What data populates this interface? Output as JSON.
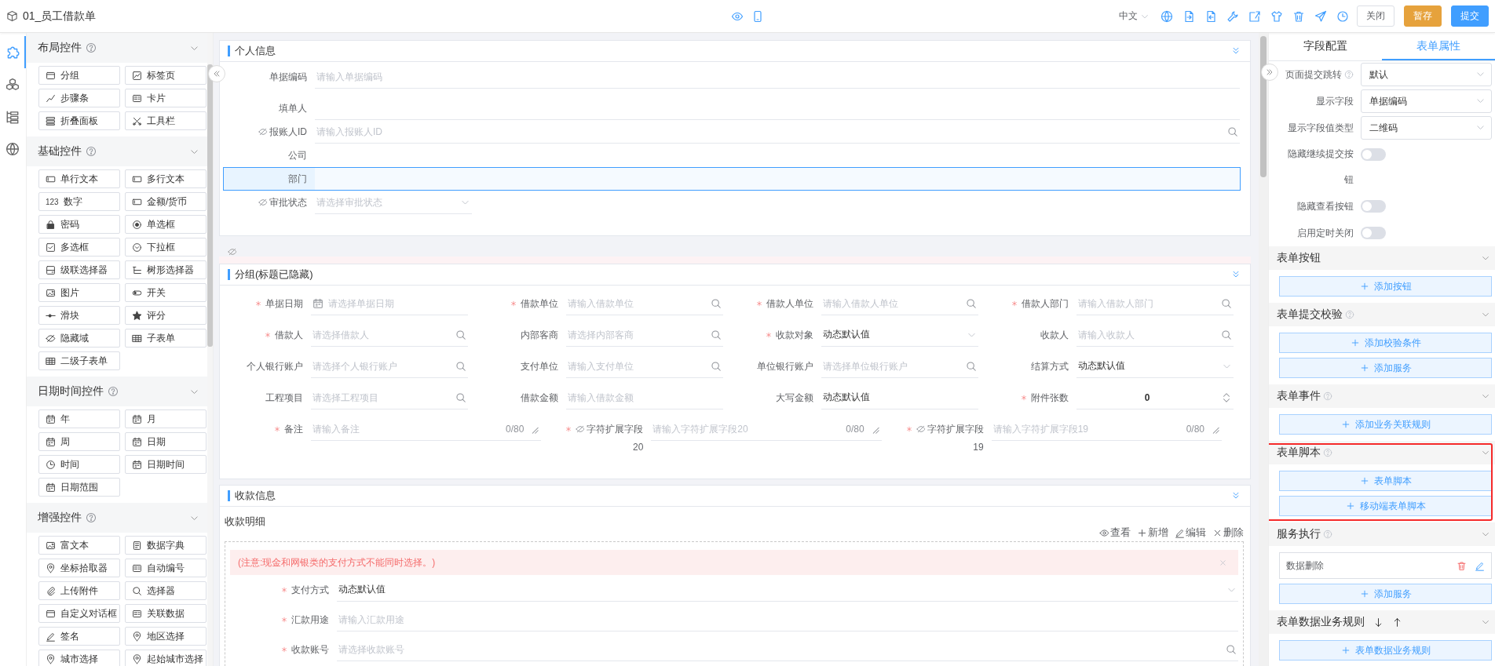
{
  "header": {
    "title": "01_员工借款单",
    "language": "中文",
    "buttons": [
      {
        "label": "关闭",
        "kind": "default"
      },
      {
        "label": "暂存",
        "kind": "warning"
      },
      {
        "label": "提交",
        "kind": "primary"
      }
    ]
  },
  "rail": [
    {
      "selected": true
    },
    {
      "selected": false
    },
    {
      "selected": false
    },
    {
      "selected": false
    }
  ],
  "palette": [
    {
      "title": "布局控件",
      "help": true,
      "items": [
        {
          "label": "分组"
        },
        {
          "label": "标签页"
        },
        {
          "label": "步骤条"
        },
        {
          "label": "卡片"
        },
        {
          "label": "折叠面板"
        },
        {
          "label": "工具栏"
        }
      ]
    },
    {
      "title": "基础控件",
      "help": true,
      "items": [
        {
          "label": "单行文本"
        },
        {
          "label": "多行文本"
        },
        {
          "label": "数字",
          "badge": "123"
        },
        {
          "label": "金额/货币"
        },
        {
          "label": "密码"
        },
        {
          "label": "单选框"
        },
        {
          "label": "多选框"
        },
        {
          "label": "下拉框"
        },
        {
          "label": "级联选择器"
        },
        {
          "label": "树形选择器"
        },
        {
          "label": "图片"
        },
        {
          "label": "开关"
        },
        {
          "label": "滑块"
        },
        {
          "label": "评分"
        },
        {
          "label": "隐藏域"
        },
        {
          "label": "子表单"
        },
        {
          "label": "二级子表单"
        }
      ]
    },
    {
      "title": "日期时间控件",
      "help": true,
      "items": [
        {
          "label": "年"
        },
        {
          "label": "月"
        },
        {
          "label": "周"
        },
        {
          "label": "日期"
        },
        {
          "label": "时间"
        },
        {
          "label": "日期时间"
        },
        {
          "label": "日期范围"
        }
      ]
    },
    {
      "title": "增强控件",
      "help": true,
      "items": [
        {
          "label": "富文本"
        },
        {
          "label": "数据字典"
        },
        {
          "label": "坐标拾取器"
        },
        {
          "label": "自动编号"
        },
        {
          "label": "上传附件"
        },
        {
          "label": "选择器"
        },
        {
          "label": "自定义对话框"
        },
        {
          "label": "关联数据"
        },
        {
          "label": "签名"
        },
        {
          "label": "地区选择"
        },
        {
          "label": "城市选择"
        },
        {
          "label": "起始城市选择"
        }
      ]
    }
  ],
  "form": {
    "sections": [
      {
        "kind": "stack",
        "title": "个人信息",
        "fields": [
          {
            "label": "单据编码",
            "kind": "input",
            "placeholder": "请输入单据编码",
            "required": false,
            "hidden": false,
            "selected": false
          },
          {
            "label": "填单人",
            "kind": "input",
            "required": false,
            "hidden": false,
            "selected": false
          },
          {
            "label": "报账人ID",
            "kind": "search",
            "placeholder": "请输入报账人ID",
            "required": false,
            "hidden": true,
            "selected": false
          },
          {
            "label": "公司",
            "kind": "static",
            "required": false,
            "hidden": false,
            "selected": false
          },
          {
            "label": "部门",
            "kind": "static",
            "required": false,
            "hidden": false,
            "selected": true
          },
          {
            "label": "审批状态",
            "kind": "select",
            "placeholder": "请选择审批状态",
            "required": false,
            "hidden": true,
            "selected": false
          }
        ]
      },
      {
        "kind": "hidden-marker"
      },
      {
        "kind": "grid",
        "title": "分组(标题已隐藏)",
        "fields": [
          {
            "label": "单据日期",
            "kind": "date",
            "placeholder": "请选择单据日期",
            "required": true,
            "hidden": false
          },
          {
            "label": "借款单位",
            "kind": "search",
            "placeholder": "请输入借款单位",
            "required": true,
            "hidden": false
          },
          {
            "label": "借款人单位",
            "kind": "search",
            "placeholder": "请输入借款人单位",
            "required": true,
            "hidden": false
          },
          {
            "label": "借款人部门",
            "kind": "search",
            "placeholder": "请输入借款人部门",
            "required": true,
            "hidden": false
          },
          {
            "label": "借款人",
            "kind": "search",
            "placeholder": "请选择借款人",
            "required": true,
            "hidden": false
          },
          {
            "label": "内部客商",
            "kind": "search",
            "placeholder": "请选择内部客商",
            "required": false,
            "hidden": false
          },
          {
            "label": "收款对象",
            "kind": "select",
            "value": "动态默认值",
            "required": true,
            "hidden": false
          },
          {
            "label": "收款人",
            "kind": "search",
            "placeholder": "请输入收款人",
            "required": false,
            "hidden": false
          },
          {
            "label": "个人银行账户",
            "kind": "search",
            "placeholder": "请选择个人银行账户",
            "required": false,
            "hidden": false
          },
          {
            "label": "支付单位",
            "kind": "search",
            "placeholder": "请输入支付单位",
            "required": false,
            "hidden": false
          },
          {
            "label": "单位银行账户",
            "kind": "search",
            "placeholder": "请选择单位银行账户",
            "required": false,
            "hidden": false
          },
          {
            "label": "结算方式",
            "kind": "select",
            "value": "动态默认值",
            "required": false,
            "hidden": false
          },
          {
            "label": "工程项目",
            "kind": "search",
            "placeholder": "请选择工程项目",
            "required": false,
            "hidden": false
          },
          {
            "label": "借款金额",
            "kind": "input",
            "placeholder": "请输入借款金额",
            "required": false,
            "hidden": false
          },
          {
            "label": "大写金额",
            "kind": "input",
            "value": "动态默认值",
            "required": false,
            "hidden": false
          },
          {
            "label": "附件张数",
            "kind": "number",
            "value": "0",
            "required": true,
            "hidden": false
          },
          {
            "label": "备注",
            "kind": "textarea",
            "placeholder": "请输入备注",
            "counter": "0/80",
            "required": true,
            "hidden": false
          },
          {
            "label": "字符扩展字段",
            "label_line2": "20",
            "kind": "textarea",
            "placeholder": "请输入字符扩展字段20",
            "counter": "0/80",
            "required": true,
            "hidden": true
          },
          {
            "label": "字符扩展字段",
            "label_line2": "19",
            "kind": "textarea",
            "placeholder": "请输入字符扩展字段19",
            "counter": "0/80",
            "required": true,
            "hidden": true
          }
        ]
      },
      {
        "kind": "subtable",
        "title": "收款信息",
        "subtitle": "收款明细",
        "actions": [
          {
            "label": "查看",
            "kind": "view"
          },
          {
            "label": "新增",
            "kind": "add"
          },
          {
            "label": "编辑",
            "kind": "edit"
          },
          {
            "label": "删除",
            "kind": "delete"
          }
        ],
        "alert": "(注意:现金和网银类的支付方式不能同时选择。)",
        "fields": [
          {
            "label": "支付方式",
            "kind": "select",
            "value": "动态默认值",
            "required": true,
            "hidden": false
          },
          {
            "label": "汇款用途",
            "kind": "input",
            "placeholder": "请输入汇款用途",
            "required": true,
            "hidden": false
          },
          {
            "label": "收款账号",
            "kind": "search",
            "placeholder": "请选择收款账号",
            "required": true,
            "hidden": false
          }
        ]
      }
    ]
  },
  "properties": {
    "tabs": [
      {
        "label": "字段配置",
        "selected": false
      },
      {
        "label": "表单属性",
        "selected": true
      }
    ],
    "settings": [
      {
        "label": "页面提交跳转",
        "help": true,
        "kind": "select",
        "value": "默认"
      },
      {
        "label": "显示字段",
        "help": false,
        "kind": "select",
        "value": "单据编码"
      },
      {
        "label": "显示字段值类型",
        "help": false,
        "kind": "select",
        "value": "二维码"
      },
      {
        "label": "隐藏继续提交按钮",
        "help": false,
        "kind": "switch",
        "on": false
      },
      {
        "label": "隐藏查看按钮",
        "help": false,
        "kind": "switch",
        "on": false
      },
      {
        "label": "启用定时关闭",
        "help": false,
        "kind": "switch",
        "on": false
      }
    ],
    "groups": [
      {
        "title": "表单按钮",
        "help": false,
        "sort": false,
        "highlighted": false,
        "buttons": [
          "添加按钮"
        ]
      },
      {
        "title": "表单提交校验",
        "help": true,
        "sort": false,
        "highlighted": false,
        "buttons": [
          "添加校验条件",
          "添加服务"
        ]
      },
      {
        "title": "表单事件",
        "help": true,
        "sort": false,
        "highlighted": false,
        "buttons": [
          "添加业务关联规则"
        ]
      },
      {
        "title": "表单脚本",
        "help": true,
        "sort": false,
        "highlighted": true,
        "buttons": [
          "表单脚本",
          "移动端表单脚本"
        ]
      },
      {
        "title": "服务执行",
        "help": true,
        "sort": false,
        "highlighted": false,
        "services": [
          "数据删除"
        ],
        "buttons": [
          "添加服务"
        ]
      },
      {
        "title": "表单数据业务规则",
        "help": false,
        "sort": true,
        "highlighted": false,
        "buttons": [
          "表单数据业务规则"
        ]
      }
    ]
  }
}
